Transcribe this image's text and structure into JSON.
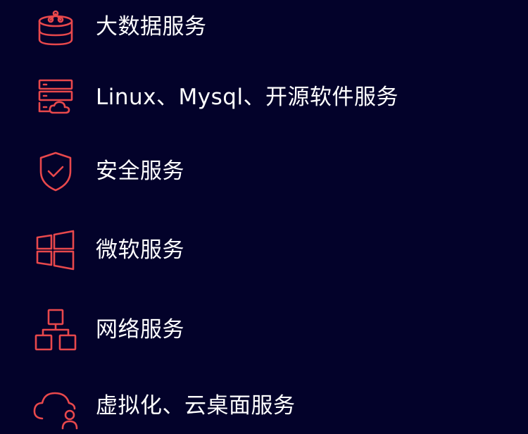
{
  "accent_color": "#e8484c",
  "background_color": "#03022a",
  "services": [
    {
      "label": "大数据服务",
      "icon": "big-data-icon"
    },
    {
      "label": "Linux、Mysql、开源软件服务",
      "icon": "server-cloud-icon"
    },
    {
      "label": "安全服务",
      "icon": "shield-check-icon"
    },
    {
      "label": "微软服务",
      "icon": "windows-icon"
    },
    {
      "label": "网络服务",
      "icon": "network-topology-icon"
    },
    {
      "label": "虚拟化、云桌面服务",
      "icon": "cloud-user-icon"
    }
  ]
}
